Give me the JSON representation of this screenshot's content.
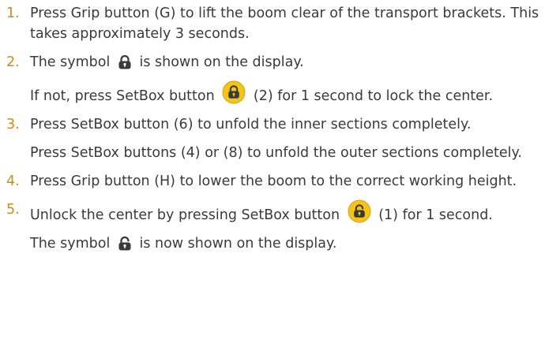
{
  "steps": [
    {
      "number": "1.",
      "lines": [
        {
          "text": "Press Grip button (G) to lift the boom clear of the transport brackets. This takes approximately 3 seconds."
        }
      ]
    },
    {
      "number": "2.",
      "lines": [
        {
          "before": "The symbol",
          "after": "is shown on the display.",
          "icon": "locked-symbol-icon"
        },
        {
          "before": "If not, press SetBox button",
          "after": "(2) for 1 second to lock the center.",
          "icon": "setbox-lock-button-icon"
        }
      ]
    },
    {
      "number": "3.",
      "lines": [
        {
          "text": "Press SetBox button (6) to unfold the inner sections completely."
        },
        {
          "text": "Press SetBox buttons (4) or (8) to unfold the outer sections completely."
        }
      ]
    },
    {
      "number": "4.",
      "lines": [
        {
          "text": "Press Grip button (H) to lower the boom to the correct working height."
        }
      ]
    },
    {
      "number": "5.",
      "lines": [
        {
          "before": "Unlock the center by pressing SetBox button",
          "after": "(1) for 1 second.",
          "icon": "setbox-unlock-button-icon"
        },
        {
          "before": "The symbol",
          "after": "is now shown on the display.",
          "icon": "unlocked-symbol-icon"
        }
      ]
    }
  ],
  "colors": {
    "text": "#3a3a3a",
    "number": "#d08a1a",
    "button_fill": "#f4c419"
  }
}
